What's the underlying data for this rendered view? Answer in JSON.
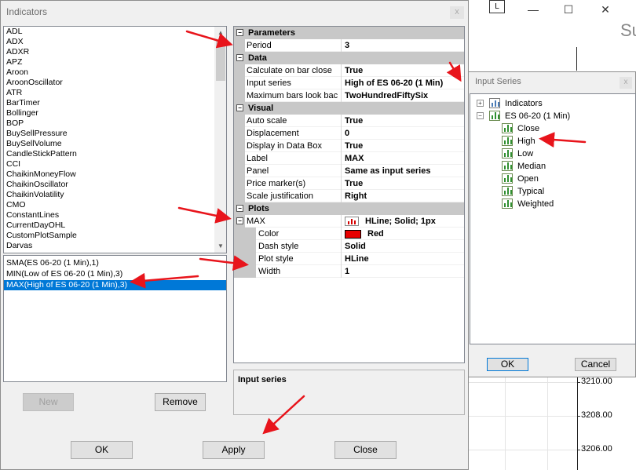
{
  "dialog": {
    "title": "Indicators",
    "close_glyph": "x"
  },
  "available_indicators": [
    "ADL",
    "ADX",
    "ADXR",
    "APZ",
    "Aroon",
    "AroonOscillator",
    "ATR",
    "BarTimer",
    "Bollinger",
    "BOP",
    "BuySellPressure",
    "BuySellVolume",
    "CandleStickPattern",
    "CCI",
    "ChaikinMoneyFlow",
    "ChaikinOscillator",
    "ChaikinVolatility",
    "CMO",
    "ConstantLines",
    "CurrentDayOHL",
    "CustomPlotSample",
    "Darvas"
  ],
  "configured_indicators": [
    {
      "label": "SMA(ES 06-20 (1 Min),1)",
      "selected": false
    },
    {
      "label": "MIN(Low of ES 06-20 (1 Min),3)",
      "selected": false
    },
    {
      "label": "MAX(High of ES 06-20 (1 Min),3)",
      "selected": true
    }
  ],
  "buttons": {
    "new": "New",
    "remove": "Remove",
    "ok": "OK",
    "apply": "Apply",
    "close": "Close"
  },
  "properties": {
    "parameters": {
      "label": "Parameters",
      "period_name": "Period",
      "period_value": "3"
    },
    "data": {
      "label": "Data",
      "calc_name": "Calculate on bar close",
      "calc_value": "True",
      "input_name": "Input series",
      "input_value": "High of ES 06-20 (1 Min)",
      "maxbars_name": "Maximum bars look bac",
      "maxbars_value": "TwoHundredFiftySix"
    },
    "visual": {
      "label": "Visual",
      "autoscale_name": "Auto scale",
      "autoscale_value": "True",
      "displacement_name": "Displacement",
      "displacement_value": "0",
      "databox_name": "Display in Data Box",
      "databox_value": "True",
      "label_name": "Label",
      "label_value": "MAX",
      "panel_name": "Panel",
      "panel_value": "Same as input series",
      "pricemarker_name": "Price marker(s)",
      "pricemarker_value": "True",
      "scalejust_name": "Scale justification",
      "scalejust_value": "Right"
    },
    "plots": {
      "label": "Plots",
      "max_name": "MAX",
      "max_value": "HLine; Solid; 1px",
      "color_name": "Color",
      "color_value": "Red",
      "color_hex": "#e80000",
      "dash_name": "Dash style",
      "dash_value": "Solid",
      "plotstyle_name": "Plot style",
      "plotstyle_value": "HLine",
      "width_name": "Width",
      "width_value": "1"
    }
  },
  "description": {
    "header": "Input series"
  },
  "input_series_popup": {
    "title": "Input Series",
    "close_glyph": "x",
    "tree": {
      "indicators": "Indicators",
      "instrument": "ES 06-20 (1 Min)",
      "children": [
        "Close",
        "High",
        "Low",
        "Median",
        "Open",
        "Typical",
        "Weighted"
      ]
    },
    "ok": "OK",
    "cancel": "Cancel"
  },
  "chart_window": {
    "button_l": "L",
    "minimize_glyph": "—",
    "maximize_glyph": "☐",
    "close_glyph": "✕",
    "title_fragment": "Su",
    "prices": [
      "3210.00",
      "3208.00",
      "3206.00"
    ]
  },
  "colors": {
    "selection": "#0078d7",
    "category_bg": "#c8c8c8",
    "arrow": "#e8141b",
    "plot_color": "#e80000"
  }
}
